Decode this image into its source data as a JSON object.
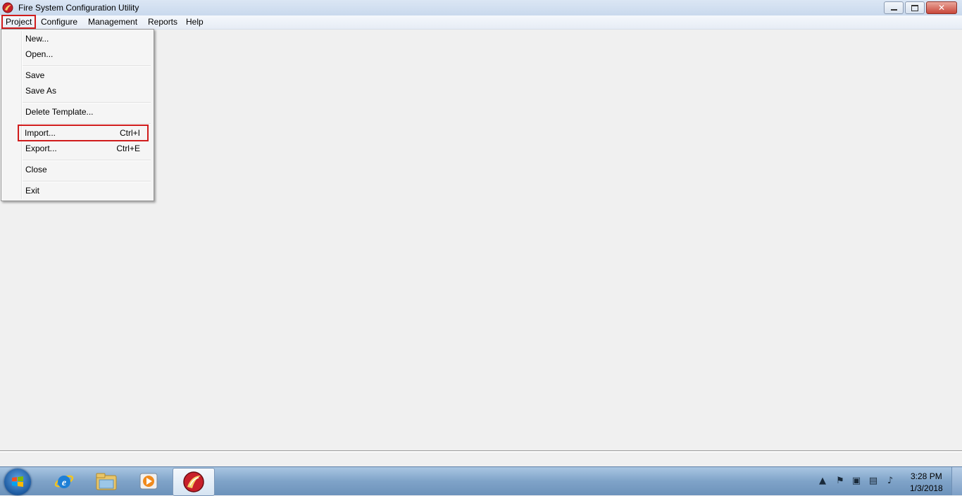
{
  "window": {
    "title": "Fire System Configuration Utility"
  },
  "menubar": {
    "items": [
      {
        "label": "Project"
      },
      {
        "label": "Configure"
      },
      {
        "label": "Management"
      },
      {
        "label": "Reports"
      },
      {
        "label": "Help"
      }
    ]
  },
  "project_menu": {
    "new": "New...",
    "open": "Open...",
    "save": "Save",
    "save_as": "Save As",
    "delete_template": "Delete Template...",
    "import": {
      "label": "Import...",
      "shortcut": "Ctrl+I"
    },
    "export": {
      "label": "Export...",
      "shortcut": "Ctrl+E"
    },
    "close": "Close",
    "exit": "Exit"
  },
  "taskbar": {
    "apps": [
      "start-icon",
      "internet-explorer-icon",
      "file-explorer-icon",
      "media-player-icon",
      "fire-system-app-icon"
    ],
    "clock": {
      "time": "3:28 PM",
      "date": "1/3/2018"
    },
    "tray_icons": [
      "chevron-up-icon",
      "action-center-icon",
      "removable-device-icon",
      "network-icon",
      "volume-icon"
    ]
  },
  "colors": {
    "highlight": "#d01c1c",
    "taskbar": "#7fa3c8"
  }
}
